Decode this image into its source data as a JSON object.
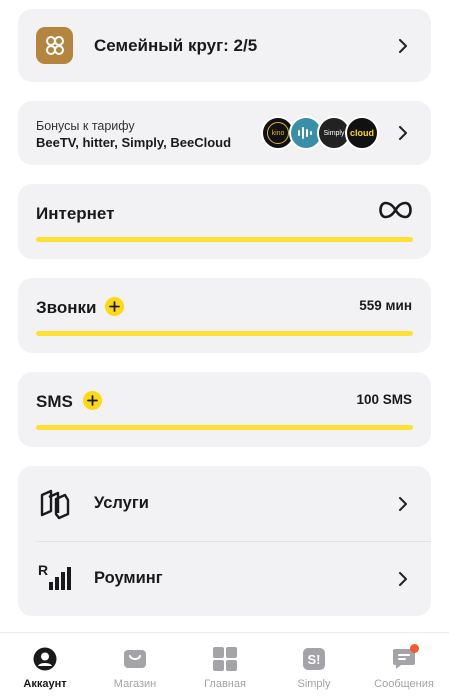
{
  "family": {
    "title": "Семейный круг: 2/5"
  },
  "bonus": {
    "label": "Бонусы к тарифу",
    "services": "BeeTV, hitter, Simply, BeeCloud",
    "logos": [
      "kino",
      "",
      "Simply",
      "cloud"
    ]
  },
  "internet": {
    "name": "Интернет",
    "amount_icon": "infinity-icon",
    "fill_percent": 100
  },
  "calls": {
    "name": "Звонки",
    "amount": "559 мин",
    "fill_percent": 100
  },
  "sms": {
    "name": "SMS",
    "amount": "100 SMS",
    "fill_percent": 100
  },
  "list": {
    "services": "Услуги",
    "roaming": "Роуминг"
  },
  "nav": {
    "items": [
      {
        "label": "Аккаунт",
        "icon": "account-icon",
        "active": true
      },
      {
        "label": "Магазин",
        "icon": "shop-icon",
        "active": false
      },
      {
        "label": "Главная",
        "icon": "home-grid-icon",
        "active": false
      },
      {
        "label": "Simply",
        "icon": "simply-icon",
        "active": false
      },
      {
        "label": "Сообщения",
        "icon": "messages-icon",
        "active": false
      }
    ]
  },
  "colors": {
    "accent": "#ffd90f",
    "card": "#f2f2f4",
    "family_icon": "#b5853f",
    "badge": "#f25c2c"
  }
}
